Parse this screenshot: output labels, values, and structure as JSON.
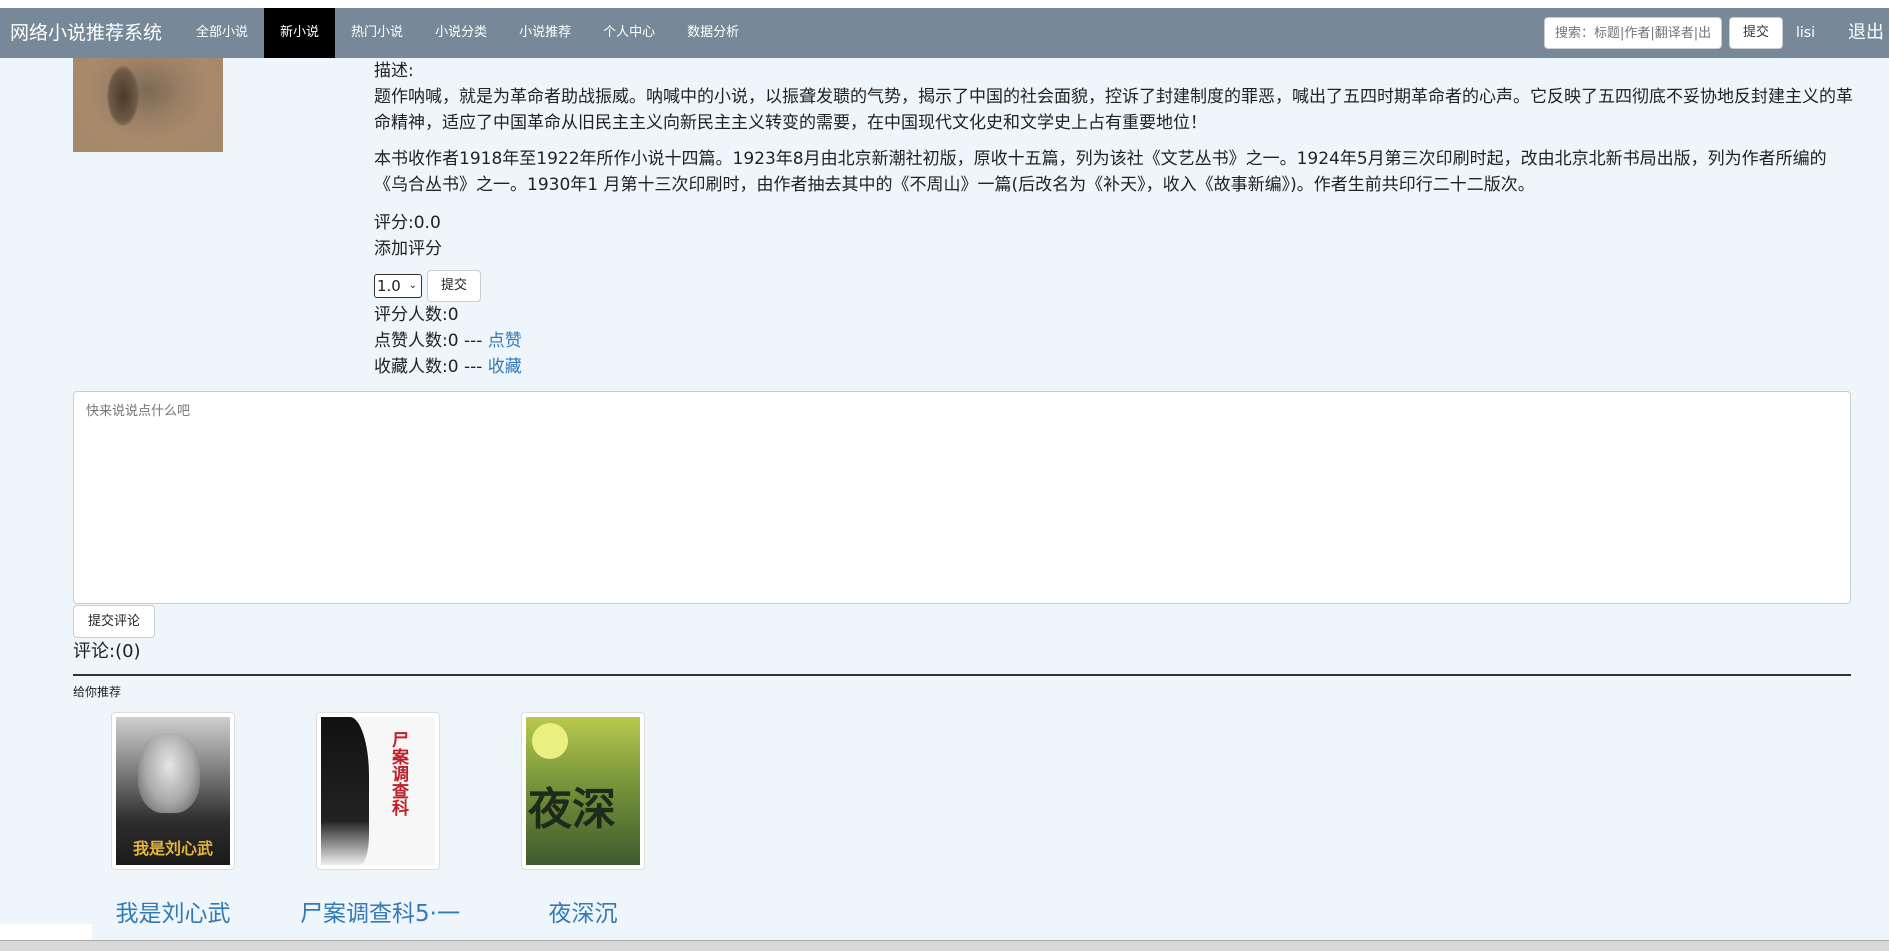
{
  "navbar": {
    "brand": "网络小说推荐系统",
    "items": [
      "全部小说",
      "新小说",
      "热门小说",
      "小说分类",
      "小说推荐",
      "个人中心",
      "数据分析"
    ],
    "active_index": 1,
    "search_placeholder": "搜索：标题|作者|翻译者|出",
    "submit_label": "提交",
    "username": "lisi",
    "logout_label": "退出"
  },
  "book": {
    "desc_label": "描述:",
    "desc_para1": "题作呐喊，就是为革命者助战振威。呐喊中的小说，以振聋发聩的气势，揭示了中国的社会面貌，控诉了封建制度的罪恶，喊出了五四时期革命者的心声。它反映了五四彻底不妥协地反封建主义的革命精神，适应了中国革命从旧民主主义向新民主主义转变的需要，在中国现代文化史和文学史上占有重要地位！",
    "desc_para2": "本书收作者1918年至1922年所作小说十四篇。1923年8月由北京新潮社初版，原收十五篇，列为该社《文艺丛书》之一。1924年5月第三次印刷时起，改由北京北新书局出版，列为作者所编的《乌合丛书》之一。1930年1 月第十三次印刷时，由作者抽去其中的《不周山》一篇(后改名为《补天》，收入《故事新编》)。作者生前共印行二十二版次。",
    "rating_text": "评分:0.0",
    "add_rating_label": "添加评分",
    "rating_select_value": "1.0",
    "rating_submit_label": "提交",
    "rating_count_text": "评分人数:0",
    "likes_text": "点赞人数:0 --- ",
    "like_link": "点赞",
    "favorites_text": "收藏人数:0 --- ",
    "favorite_link": "收藏"
  },
  "comment": {
    "placeholder": "快来说说点什么吧",
    "submit_label": "提交评论",
    "count_text": "评论:(0)"
  },
  "recommend": {
    "title": "给你推荐",
    "books": [
      {
        "title": "我是刘心武",
        "cover_caption": "我是刘心武"
      },
      {
        "title": "尸案调查科5·一",
        "cover_caption": "尸案调查科"
      },
      {
        "title": "夜深沉",
        "cover_caption": "夜深"
      }
    ]
  }
}
